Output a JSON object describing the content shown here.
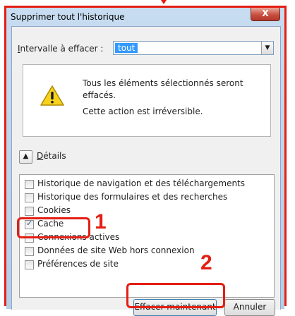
{
  "window": {
    "title": "Supprimer tout l'historique",
    "close_glyph": "X"
  },
  "range": {
    "label_underlined": "I",
    "label_rest": "ntervalle à effacer :",
    "selected": "tout"
  },
  "warning": {
    "icon": "warning-triangle-icon",
    "line1": "Tous les éléments sélectionnés seront effacés.",
    "line2": "Cette action est irréversible."
  },
  "details": {
    "toggle_glyph": "▲",
    "label_underlined": "D",
    "label_rest": "étails"
  },
  "items": [
    {
      "label": "Historique de navigation et des téléchargements",
      "checked": false
    },
    {
      "label": "Historique des formulaires et des recherches",
      "checked": false
    },
    {
      "label": "Cookies",
      "checked": false
    },
    {
      "label": "Cache",
      "checked": true
    },
    {
      "label": "Connexions actives",
      "checked": false
    },
    {
      "label": "Données de site Web hors connexion",
      "checked": false
    },
    {
      "label": "Préférences de site",
      "checked": false
    }
  ],
  "buttons": {
    "clear_now": "Effacer maintenant",
    "cancel": "Annuler"
  },
  "annotations": {
    "step1": "1",
    "step2": "2",
    "color": "#e41e13"
  }
}
